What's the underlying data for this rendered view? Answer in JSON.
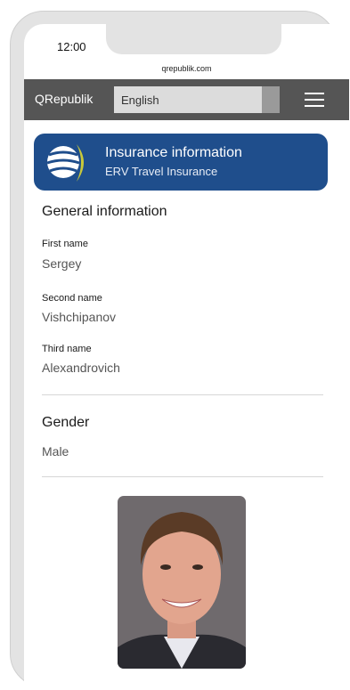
{
  "status": {
    "time": "12:00"
  },
  "browser": {
    "url": "qrepublik.com"
  },
  "navbar": {
    "brand": "QRepublik",
    "language": "English"
  },
  "banner": {
    "title": "Insurance information",
    "subtitle": "ERV Travel Insurance"
  },
  "general": {
    "heading": "General information",
    "fields": [
      {
        "label": "First name",
        "value": "Sergey"
      },
      {
        "label": "Second name",
        "value": "Vishchipanov"
      },
      {
        "label": "Third name",
        "value": "Alexandrovich"
      }
    ]
  },
  "gender": {
    "heading": "Gender",
    "value": "Male"
  },
  "colors": {
    "navbar": "#555555",
    "banner": "#1f4e8c",
    "logo_accent": "#c9c93a"
  },
  "icons": [
    "globe-logo-icon",
    "hamburger-menu-icon"
  ]
}
